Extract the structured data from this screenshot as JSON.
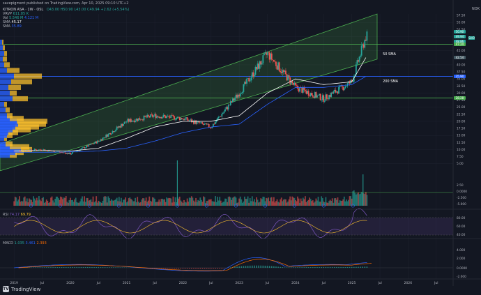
{
  "publish_line": "savepigment published on TradingView.com, Apr 10, 2025 09:10 UTC+2",
  "symbol_line": "KITRON ASA · 1W · OSL",
  "ohlc": "O43.00 H50.90 L43.00 C49.94 +2.62 (+5.54%)",
  "vrvp": {
    "label": "VRVP",
    "value": "611.85 K"
  },
  "vol": {
    "label": "Vol",
    "value": "5.546 M",
    "extra": "4.121 M"
  },
  "sma1": {
    "label": "SMA",
    "value": "45.17"
  },
  "sma2": {
    "label": "SMA",
    "value": "35.89"
  },
  "currency": "NOK",
  "annotations": {
    "sma50": "50 SMA",
    "sma200": "200 SMA"
  },
  "colors": {
    "bg": "#131722",
    "up": "#26a69a",
    "down": "#ef5350",
    "sma50": "#ffffff",
    "sma200": "#2962ff",
    "channel": "#4caf50",
    "rsi": "#7e57c2",
    "macd": "#2962ff",
    "signal": "#ff6d00",
    "vp_up": "#2962ff",
    "vp_down": "#fbc02d",
    "grid": "#1e2230"
  },
  "price_scale": [
    "57.50",
    "55.00",
    "52.50",
    "50.00",
    "47.50",
    "45.00",
    "42.50",
    "40.00",
    "37.50",
    "35.00",
    "32.50",
    "30.00",
    "27.50",
    "25.00",
    "22.50",
    "20.00",
    "17.50",
    "15.00",
    "12.50",
    "10.00",
    "7.50",
    "5.00",
    "2.50",
    "0.0000",
    "-2.500",
    "-5.000"
  ],
  "price_boxes": [
    {
      "label": "50.90",
      "price": 50.9,
      "color": "#26a69a"
    },
    {
      "label": "49.94",
      "price": 49.94,
      "color": "#26a69a"
    },
    {
      "label": "48.86",
      "price": 48.86,
      "color": "#26a69a"
    },
    {
      "label": "47.24",
      "price": 47.24,
      "color": "#4caf50"
    },
    {
      "label": "42.54",
      "price": 42.54,
      "color": "#455a64"
    },
    {
      "label": "35.90",
      "price": 35.9,
      "color": "#2962ff"
    },
    {
      "label": "28.28",
      "price": 28.28,
      "color": "#4caf50"
    }
  ],
  "side_badge": "SHO",
  "rsi": {
    "label": "RSI",
    "value1": "74.17",
    "value2": "69.79",
    "scale": [
      "80.00",
      "60.00",
      "40.00"
    ]
  },
  "macd": {
    "label": "MACD",
    "values": [
      "1.035",
      "3.461",
      "2.393"
    ],
    "scale": [
      "4.000",
      "2.000",
      "0.0000",
      "-2.000"
    ]
  },
  "time_axis": [
    "2019",
    "Jul",
    "2020",
    "Jul",
    "2021",
    "Jul",
    "2022",
    "Jul",
    "2023",
    "Jul",
    "2024",
    "Jul",
    "2025",
    "Jul",
    "2026",
    "Jul"
  ],
  "brand": "TradingView",
  "chart_data": {
    "type": "candlestick",
    "symbol": "KITRON ASA",
    "interval": "1W",
    "x": [
      "2019",
      "2019.5",
      "2020",
      "2020.5",
      "2021",
      "2021.5",
      "2022",
      "2022.5",
      "2023",
      "2023.5",
      "2024",
      "2024.5",
      "2025",
      "2025.25"
    ],
    "close": [
      9.5,
      10.0,
      8.5,
      13,
      20,
      22,
      21,
      18,
      30,
      44,
      32,
      28,
      34,
      49.94
    ],
    "sma50": [
      9.5,
      9.6,
      9.5,
      10.5,
      14,
      18,
      20,
      20,
      22,
      30,
      35,
      33,
      34,
      42.54
    ],
    "sma200": [
      9,
      9,
      9.2,
      9.5,
      10.5,
      13,
      16,
      18,
      19,
      26,
      32,
      32,
      33,
      35.9
    ],
    "channel": {
      "lower_start": 2.5,
      "lower_end": 42,
      "upper_start": 12,
      "upper_end": 58
    },
    "horizontal_levels": [
      47.24,
      35.9,
      28.28
    ],
    "ylim": [
      0,
      58
    ]
  }
}
